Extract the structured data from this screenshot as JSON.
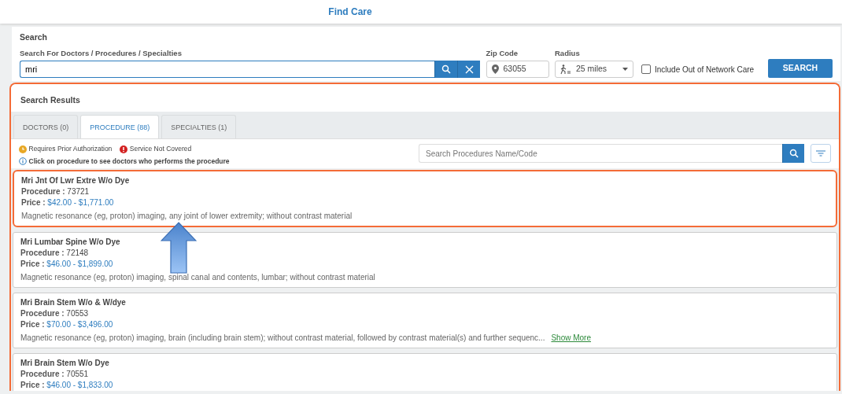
{
  "header": {
    "title": "Find Care"
  },
  "search": {
    "title": "Search",
    "query_label": "Search For Doctors / Procedures / Specialties",
    "query": "mri",
    "zip_label": "Zip Code",
    "zip": "63055",
    "radius_label": "Radius",
    "radius": "25 miles",
    "out_of_network": {
      "label": "Include Out of Network Care",
      "checked": false
    },
    "button": "SEARCH"
  },
  "results": {
    "title": "Search Results",
    "highlighted": true,
    "tabs": [
      {
        "label": "DOCTORS (0)",
        "selected": false
      },
      {
        "label": "PROCEDURE (88)",
        "selected": true
      },
      {
        "label": "SPECIALTIES (1)",
        "selected": false
      }
    ],
    "legend": [
      {
        "kind": "prior",
        "label": "Requires Prior Authorization"
      },
      {
        "kind": "not_covered",
        "label": "Service Not Covered"
      }
    ],
    "hint": "Click on procedure to see doctors who performs the procedure",
    "filter_placeholder": "Search Procedures Name/Code",
    "procedures": [
      {
        "name": "Mri Jnt Of Lwr Extre W/o Dye",
        "code_label": "Procedure :",
        "code": "73721",
        "price_label": "Price :",
        "price": "$42.00 - $1,771.00",
        "description": "Magnetic resonance (eg, proton) imaging, any joint of lower extremity; without contrast material",
        "highlighted": true
      },
      {
        "name": "Mri Lumbar Spine W/o Dye",
        "code_label": "Procedure :",
        "code": "72148",
        "price_label": "Price :",
        "price": "$46.00 - $1,899.00",
        "description": "Magnetic resonance (eg, proton) imaging, spinal canal and contents, lumbar; without contrast material",
        "highlighted": false
      },
      {
        "name": "Mri Brain Stem W/o & W/dye",
        "code_label": "Procedure :",
        "code": "70553",
        "price_label": "Price :",
        "price": "$70.00 - $3,496.00",
        "description": "Magnetic resonance (eg, proton) imaging, brain (including brain stem); without contrast material, followed by contrast material(s) and further sequenc...",
        "show_more": "Show More",
        "highlighted": false
      },
      {
        "name": "Mri Brain Stem W/o Dye",
        "code_label": "Procedure :",
        "code": "70551",
        "price_label": "Price :",
        "price": "$46.00 - $1,833.00",
        "highlighted": false
      }
    ]
  }
}
